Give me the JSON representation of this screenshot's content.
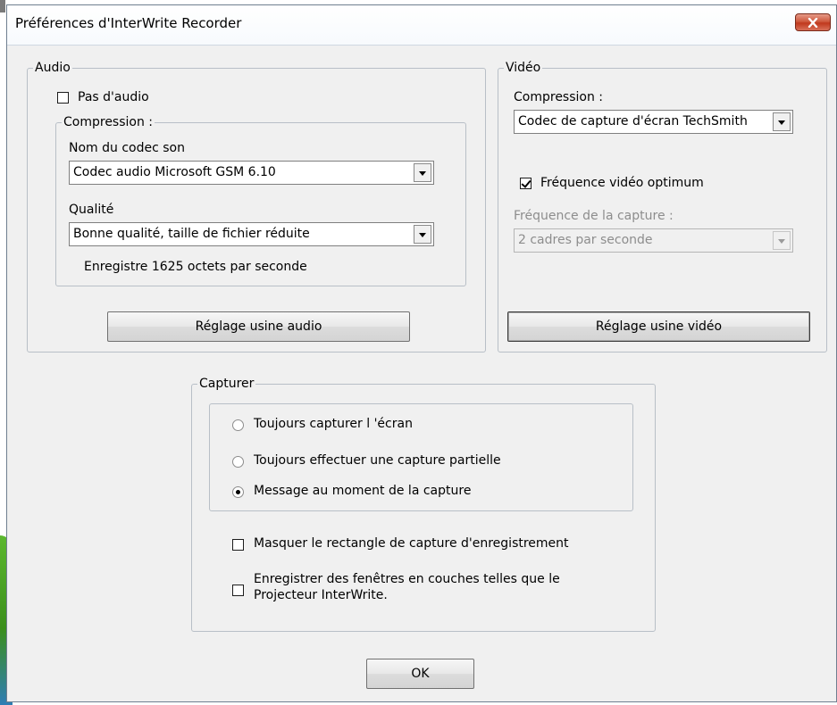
{
  "window": {
    "title": "Préférences d'InterWrite Recorder"
  },
  "audio": {
    "group_label": "Audio",
    "no_audio_label": "Pas d'audio",
    "no_audio_checked": false,
    "compression_group_label": "Compression :",
    "codec_label": "Nom du codec son",
    "codec_value": "Codec audio Microsoft GSM 6.10",
    "quality_label": "Qualité",
    "quality_value": "Bonne qualité, taille de fichier réduite",
    "bytes_info": "Enregistre 1625 octets par seconde",
    "factory_button": "Réglage usine audio"
  },
  "video": {
    "group_label": "Vidéo",
    "compression_label": "Compression :",
    "compression_value": "Codec de capture d'écran TechSmith",
    "optimum_label": "Fréquence vidéo optimum",
    "optimum_checked": true,
    "capture_freq_label": "Fréquence de la capture :",
    "capture_freq_value": "2 cadres par seconde",
    "factory_button": "Réglage usine vidéo"
  },
  "capture": {
    "group_label": "Capturer",
    "options": [
      {
        "label": "Toujours capturer l 'écran",
        "selected": false
      },
      {
        "label": "Toujours effectuer une capture partielle",
        "selected": false
      },
      {
        "label": "Message au moment de la capture",
        "selected": true
      }
    ],
    "hide_rect_label": "Masquer le rectangle de capture d'enregistrement",
    "hide_rect_checked": false,
    "layered_label_line1": "Enregistrer des fenêtres en couches telles que le",
    "layered_label_line2": "Projecteur InterWrite.",
    "layered_checked": false
  },
  "ok_button": "OK",
  "icons": {
    "close": "close-icon",
    "dropdown": "chevron-down-icon"
  },
  "colors": {
    "close_button": "#c0391d",
    "dialog_background": "#f0f0f0"
  }
}
